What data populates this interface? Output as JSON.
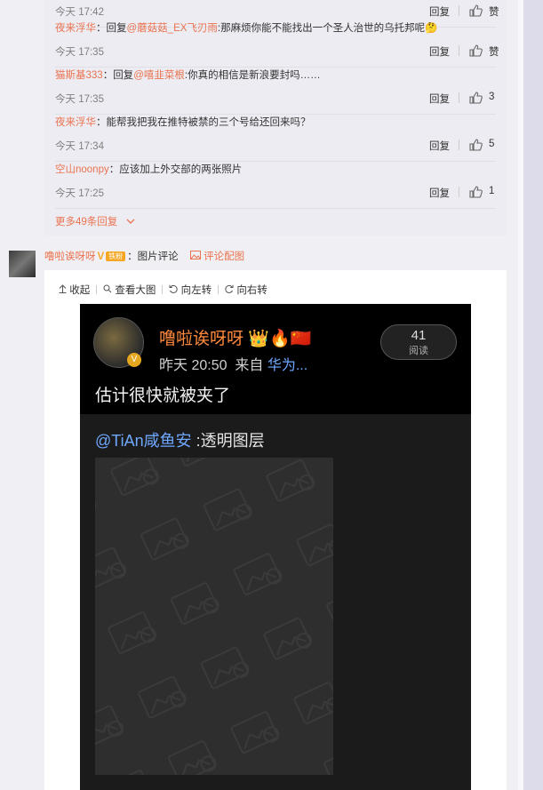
{
  "replies": [
    {
      "user": "",
      "sep": "",
      "prefix": "",
      "mention": "",
      "text": "",
      "time": "今天 17:42",
      "reply_label": "回复",
      "likes": "赞"
    },
    {
      "user": "夜来浮华",
      "sep": "：",
      "prefix": "回复",
      "mention": "@蘑菇菇_EX飞刃雨",
      "text": ":那麻烦你能不能找出一个圣人治世的乌托邦呢",
      "time": "今天 17:35",
      "reply_label": "回复",
      "likes": "赞"
    },
    {
      "user": "猫斯基333",
      "sep": "：",
      "prefix": "回复",
      "mention": "@嘻韭菜根",
      "text": ":你真的相信是新浪要封吗……",
      "time": "今天 17:35",
      "reply_label": "回复",
      "likes": "3"
    },
    {
      "user": "夜来浮华",
      "sep": "：",
      "prefix": "",
      "mention": "",
      "text": "能帮我把我在推特被禁的三个号给还回来吗？",
      "time": "今天 17:34",
      "reply_label": "回复",
      "likes": "5"
    },
    {
      "user": "空山noonpy",
      "sep": "：",
      "prefix": "",
      "mention": "",
      "text": "应该加上外交部的两张照片",
      "time": "今天 17:25",
      "reply_label": "回复",
      "likes": "1"
    }
  ],
  "more_replies": "更多49条回复",
  "comment": {
    "user": "噜啦诶呀呀",
    "badge": "V",
    "fan_badge": "铁粉",
    "sep": "：",
    "text": "图片评论",
    "pic_link": "评论配图"
  },
  "toolbar": {
    "collapse": "收起",
    "view_large": "查看大图",
    "rotate_left": "向左转",
    "rotate_right": "向右转"
  },
  "screenshot": {
    "name": "噜啦诶呀呀",
    "time": "昨天 20:50",
    "source_prefix": "来自",
    "source": "华为...",
    "reads_count": "41",
    "reads_label": "阅读",
    "post_text": "估计很快就被夹了",
    "quote_user": "@TiAn咸鱼安",
    "quote_text": " :透明图层"
  },
  "colors": {
    "accent": "#eb7350",
    "link_blue": "#6fa8ff"
  }
}
